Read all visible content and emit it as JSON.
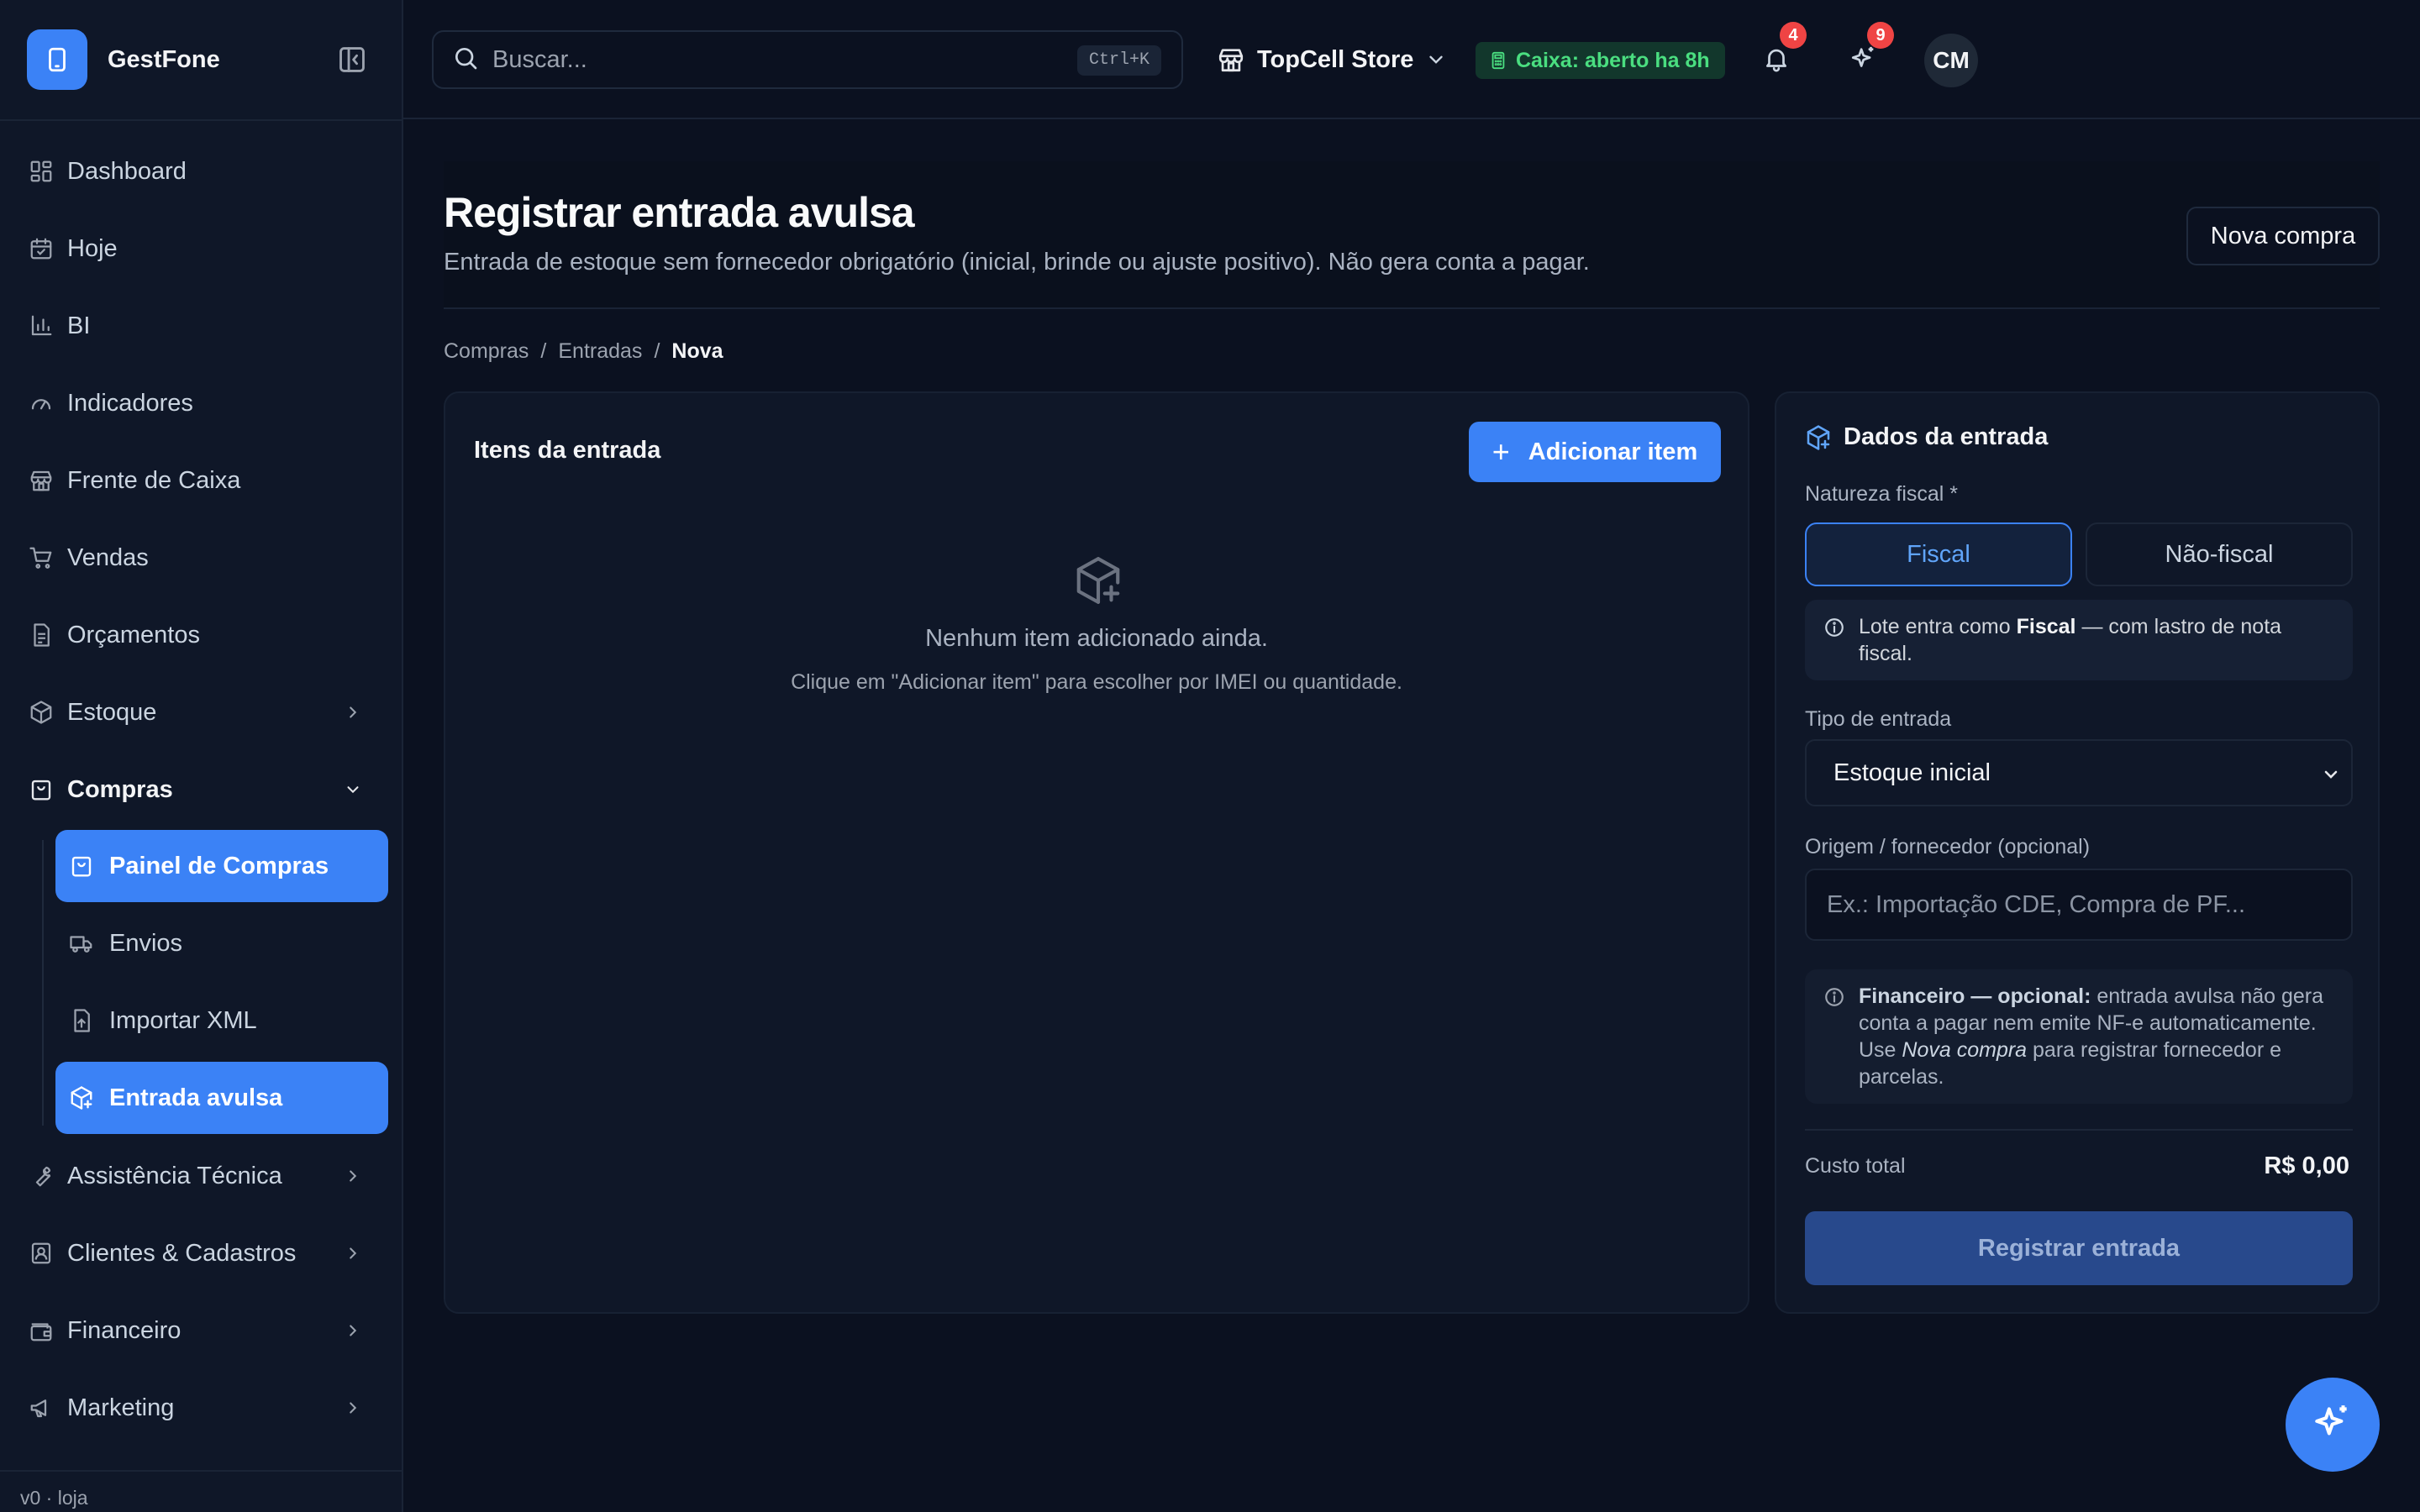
{
  "app": {
    "name": "GestFone",
    "version": "v0 · loja"
  },
  "colors": {
    "accent": "#3b82f6",
    "background": "#0b1120",
    "success": "#4ade80",
    "danger": "#ef4444"
  },
  "sidebar": {
    "items": [
      {
        "label": "Dashboard",
        "icon": "dashboard-icon"
      },
      {
        "label": "Hoje",
        "icon": "calendar-icon"
      },
      {
        "label": "BI",
        "icon": "bar-chart-icon"
      },
      {
        "label": "Indicadores",
        "icon": "gauge-icon"
      },
      {
        "label": "Frente de Caixa",
        "icon": "store-icon"
      },
      {
        "label": "Vendas",
        "icon": "cart-icon"
      },
      {
        "label": "Orçamentos",
        "icon": "document-icon"
      },
      {
        "label": "Estoque",
        "icon": "package-icon"
      },
      {
        "label": "Compras",
        "icon": "shopping-bag-icon"
      },
      {
        "label": "Assistência Técnica",
        "icon": "wrench-icon"
      },
      {
        "label": "Clientes & Cadastros",
        "icon": "contact-icon"
      },
      {
        "label": "Financeiro",
        "icon": "wallet-icon"
      },
      {
        "label": "Marketing",
        "icon": "megaphone-icon"
      }
    ],
    "compras_sub": [
      {
        "label": "Painel de Compras",
        "icon": "shopping-bag-icon",
        "active": true
      },
      {
        "label": "Envios",
        "icon": "truck-icon",
        "active": false
      },
      {
        "label": "Importar XML",
        "icon": "file-upload-icon",
        "active": false
      },
      {
        "label": "Entrada avulsa",
        "icon": "package-plus-icon",
        "active": true
      }
    ]
  },
  "topbar": {
    "search_placeholder": "Buscar...",
    "shortcut": "Ctrl+K",
    "store": "TopCell Store",
    "caixa_status": "Caixa: aberto ha 8h",
    "notifications_count": "4",
    "ai_count": "9",
    "avatar_initials": "CM"
  },
  "page": {
    "title": "Registrar entrada avulsa",
    "subtitle": "Entrada de estoque sem fornecedor obrigatório (inicial, brinde ou ajuste positivo). Não gera conta a pagar.",
    "new_purchase_button": "Nova compra",
    "breadcrumb": [
      "Compras",
      "Entradas",
      "Nova"
    ]
  },
  "items_card": {
    "title": "Itens da entrada",
    "add_button": "Adicionar item",
    "empty_title": "Nenhum item adicionado ainda.",
    "empty_hint": "Clique em \"Adicionar item\" para escolher por IMEI ou quantidade."
  },
  "data_card": {
    "title": "Dados da entrada",
    "fiscal_label": "Natureza fiscal *",
    "fiscal_options": [
      "Fiscal",
      "Não-fiscal"
    ],
    "fiscal_selected": "Fiscal",
    "fiscal_note": {
      "prefix": "Lote entra como ",
      "bold": "Fiscal",
      "suffix": " — com lastro de nota fiscal."
    },
    "tipo_label": "Tipo de entrada",
    "tipo_value": "Estoque inicial",
    "origem_label": "Origem / fornecedor (opcional)",
    "origem_placeholder": "Ex.: Importação CDE, Compra de PF...",
    "financeiro_note": {
      "bold": "Financeiro — opcional:",
      "text1": " entrada avulsa não gera conta a pagar nem emite NF-e automaticamente. Use ",
      "italic": "Nova compra",
      "text2": " para registrar fornecedor e parcelas."
    },
    "total_label": "Custo total",
    "total_value": "R$ 0,00",
    "submit_button": "Registrar entrada"
  }
}
